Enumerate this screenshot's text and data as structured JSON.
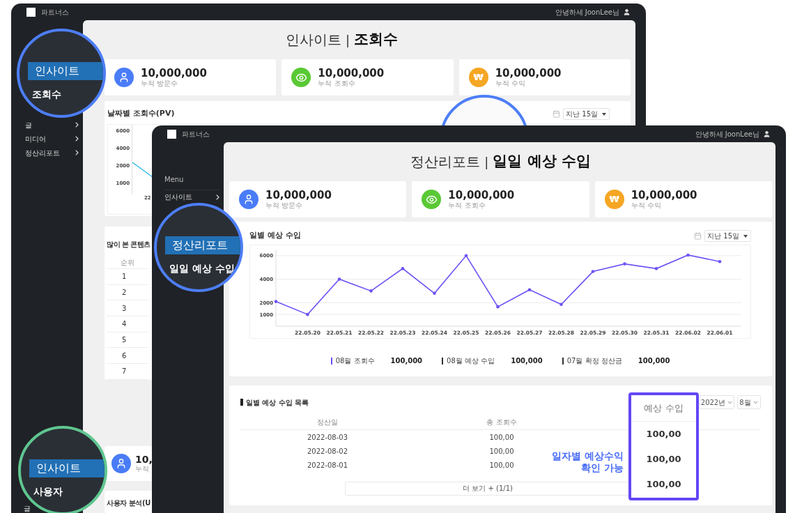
{
  "back_window": {
    "logo_text": "파트너스",
    "greeting": "안녕하세 JoonLee님",
    "sidebar": {
      "items": [
        {
          "label": "글"
        },
        {
          "label": "미디어"
        },
        {
          "label": "정산리포트"
        }
      ],
      "bottom_item": "글"
    },
    "page_title": {
      "section": "인사이트",
      "separator": "|",
      "page": "조회수"
    },
    "stats": [
      {
        "kind": "user",
        "value": "10,000,000",
        "label": "누적 방문수"
      },
      {
        "kind": "eye",
        "value": "10,000,000",
        "label": "누적 조회수"
      },
      {
        "kind": "won",
        "symbol": "₩",
        "value": "10,000,000",
        "label": "누적 수익"
      }
    ],
    "chart_card": {
      "title": "날짜별 조회수(PV)",
      "range_select": "지난 15일",
      "y_axis_labels": [
        "6000",
        "4000",
        "2000",
        "1000"
      ],
      "x_axis_labels": [
        "22"
      ]
    },
    "top_content": {
      "title": "많이 본 콘텐츠",
      "column": "순위",
      "rows": [
        "1",
        "2",
        "3",
        "4",
        "5",
        "6",
        "7"
      ]
    },
    "user_stat": {
      "kind": "user",
      "value": "10,",
      "label": "누적"
    },
    "user_analysis_title": "사용자 분석(U"
  },
  "front_window": {
    "logo_text": "파트너스",
    "greeting": "안녕하세 JoonLee님",
    "sidebar": {
      "heading": "Menu",
      "items": [
        {
          "label": "인사이트"
        }
      ]
    },
    "page_title": {
      "section": "정산리포트",
      "separator": "|",
      "page": "일일 예상 수입"
    },
    "stats": [
      {
        "kind": "user",
        "value": "10,000,000",
        "label": "누적 방문수"
      },
      {
        "kind": "eye",
        "value": "10,000,000",
        "label": "누적 조회수"
      },
      {
        "kind": "won",
        "symbol": "₩",
        "value": "10,000,000",
        "label": "누적 수익"
      }
    ],
    "chart_card": {
      "title": "일별 예상 수입",
      "range_select": "지난 15일",
      "chart_data": {
        "type": "line",
        "categories": [
          null,
          "22.05.20",
          "22.05.21",
          "22.05.22",
          "22.05.23",
          "22.05.24",
          "22.05.25",
          "22.05.26",
          "22.05.27",
          "22.05.28",
          "22.05.29",
          "22.05.30",
          "22.05.31",
          "22.06.02",
          "22.06.01"
        ],
        "yticks": [
          1000,
          2000,
          4000,
          6000
        ],
        "ylim": [
          0,
          6500
        ],
        "grid": true,
        "series": [
          {
            "color": "#7052f5",
            "values": [
              2100,
              1000,
              4000,
              3000,
              4900,
              2800,
              6000,
              1650,
              3100,
              1850,
              4650,
              5300,
              4900,
              6050,
              5500
            ]
          }
        ]
      }
    },
    "legend": [
      {
        "label": "08월 조회수",
        "value": "100,000",
        "color": "#6c4cf5"
      },
      {
        "label": "08월 예상 수입",
        "value": "100,000",
        "color": "#333333"
      },
      {
        "label": "07월 확정 정산금",
        "value": "100,000",
        "color": "#333333"
      }
    ],
    "list_card": {
      "title": "일별 예상 수입 목록",
      "year_select": "2022년",
      "month_select": "8월",
      "columns": [
        "정산일",
        "총 조회수"
      ],
      "rows": [
        [
          "2022-08-03",
          "100,00"
        ],
        [
          "2022-08-02",
          "100,00"
        ],
        [
          "2022-08-01",
          "100,00"
        ]
      ],
      "more_button": "더 보기 + (1/1)"
    },
    "highlight_column": {
      "header": "예상 수입",
      "values": [
        "100,00",
        "100,00",
        "100,00"
      ]
    },
    "annotation": [
      "일자별 예상수익",
      "확인 가능"
    ]
  },
  "callouts": [
    {
      "kind": "menu",
      "color": "#4d7ef7",
      "highlight": "인사이트",
      "item": "조회수"
    },
    {
      "kind": "ring",
      "color": "#4d7ef7"
    },
    {
      "kind": "menu",
      "color": "#4d7ef7",
      "highlight": "정산리포트",
      "item": "일일 예상 수입"
    },
    {
      "kind": "menu",
      "color": "#5fc690",
      "highlight": "인사이트",
      "item": "사용자"
    }
  ]
}
